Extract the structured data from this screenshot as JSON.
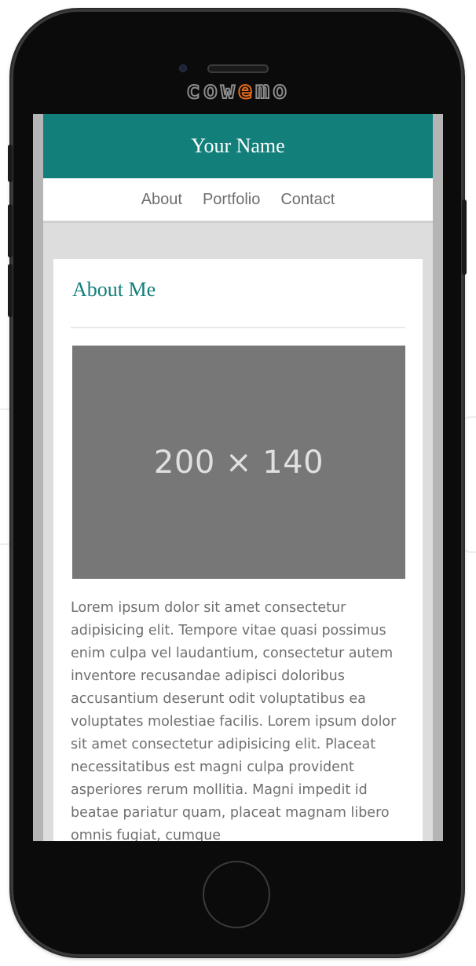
{
  "device": {
    "brand_prefix": "cow",
    "brand_accent": "e",
    "brand_suffix": "mo",
    "brand_accent_color": "#e36b1c"
  },
  "site": {
    "title": "Your Name",
    "header_color": "#137f7a"
  },
  "nav": {
    "items": [
      {
        "label": "About"
      },
      {
        "label": "Portfolio"
      },
      {
        "label": "Contact"
      }
    ]
  },
  "main": {
    "heading": "About Me",
    "image_placeholder": "200 × 140",
    "paragraph": "Lorem ipsum dolor sit amet consectetur adipisicing elit. Tempore vitae quasi possimus enim culpa vel laudantium, consectetur autem inventore recusandae adipisci doloribus accusantium deserunt odit voluptatibus ea voluptates molestiae facilis. Lorem ipsum dolor sit amet consectetur adipisicing elit. Placeat necessitatibus est magni culpa provident asperiores rerum mollitia. Magni impedit id beatae pariatur quam, placeat magnam libero omnis fugiat, cumque"
  }
}
